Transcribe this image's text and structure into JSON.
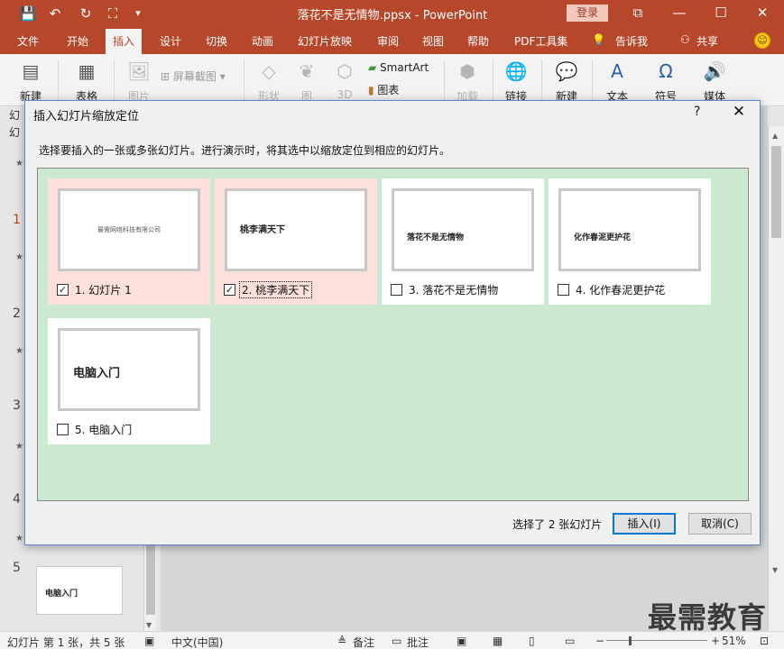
{
  "window": {
    "title": "落花不是无情物.ppsx  -  PowerPoint",
    "login_label": "登录",
    "controls": [
      "⧉",
      "—",
      "☐",
      "✕"
    ]
  },
  "quick_access": [
    "save-icon",
    "undo-icon",
    "redo-icon",
    "present-icon",
    "customize-icon"
  ],
  "tabs": {
    "items": [
      {
        "label": "文件"
      },
      {
        "label": "开始"
      },
      {
        "label": "插入"
      },
      {
        "label": "设计"
      },
      {
        "label": "切换"
      },
      {
        "label": "动画"
      },
      {
        "label": "幻灯片放映"
      },
      {
        "label": "审阅"
      },
      {
        "label": "视图"
      },
      {
        "label": "帮助"
      },
      {
        "label": "PDF工具集"
      }
    ],
    "tellme": "告诉我",
    "share": "共享",
    "active": "插入"
  },
  "ribbon": {
    "new_slide": "新建",
    "table": "表格",
    "picture": "图片",
    "screenshot": "屏幕截图",
    "shapes": "形状",
    "icons": "图",
    "models3d": "3D",
    "smartart": "SmartArt",
    "chart": "图表",
    "addins": "加载",
    "links": "链接",
    "comment": "新建",
    "text": "文本",
    "symbols": "符号",
    "media": "媒体"
  },
  "left_pane": {
    "header_1": "幻",
    "header_2": "幻",
    "slide_numbers": [
      "1",
      "2",
      "3",
      "4",
      "5"
    ],
    "slide5_title": "电脑入门"
  },
  "dialog": {
    "title": "插入幻灯片缩放定位",
    "help": "?",
    "close": "✕",
    "instructions": "选择要插入的一张或多张幻灯片。进行演示时，将其选中以缩放定位到相应的幻灯片。",
    "slides": [
      {
        "label": "1. 幻灯片 1",
        "thumb_text": "最需网络科技有限公司",
        "checked": true
      },
      {
        "label": "2. 桃李满天下",
        "thumb_text": "桃李满天下",
        "checked": true
      },
      {
        "label": "3. 落花不是无情物",
        "thumb_text": "落花不是无情物",
        "checked": false
      },
      {
        "label": "4. 化作春泥更护花",
        "thumb_text": "化作春泥更护花",
        "checked": false
      },
      {
        "label": "5. 电脑入门",
        "thumb_text": "电脑入门",
        "checked": false
      }
    ],
    "status": "选择了 2 张幻灯片",
    "insert_button": "插入(I)",
    "cancel_button": "取消(C)"
  },
  "statusbar": {
    "slide_info": "幻灯片 第 1 张，共 5 张",
    "language": "中文(中国)",
    "notes": "备注",
    "comments": "批注",
    "zoom": "51%"
  },
  "watermark": "最需教育",
  "colors": {
    "accent": "#b7472a",
    "selected_card": "#fde0d9",
    "grid_bg": "#cce8cf",
    "primary_border": "#0078d7"
  }
}
